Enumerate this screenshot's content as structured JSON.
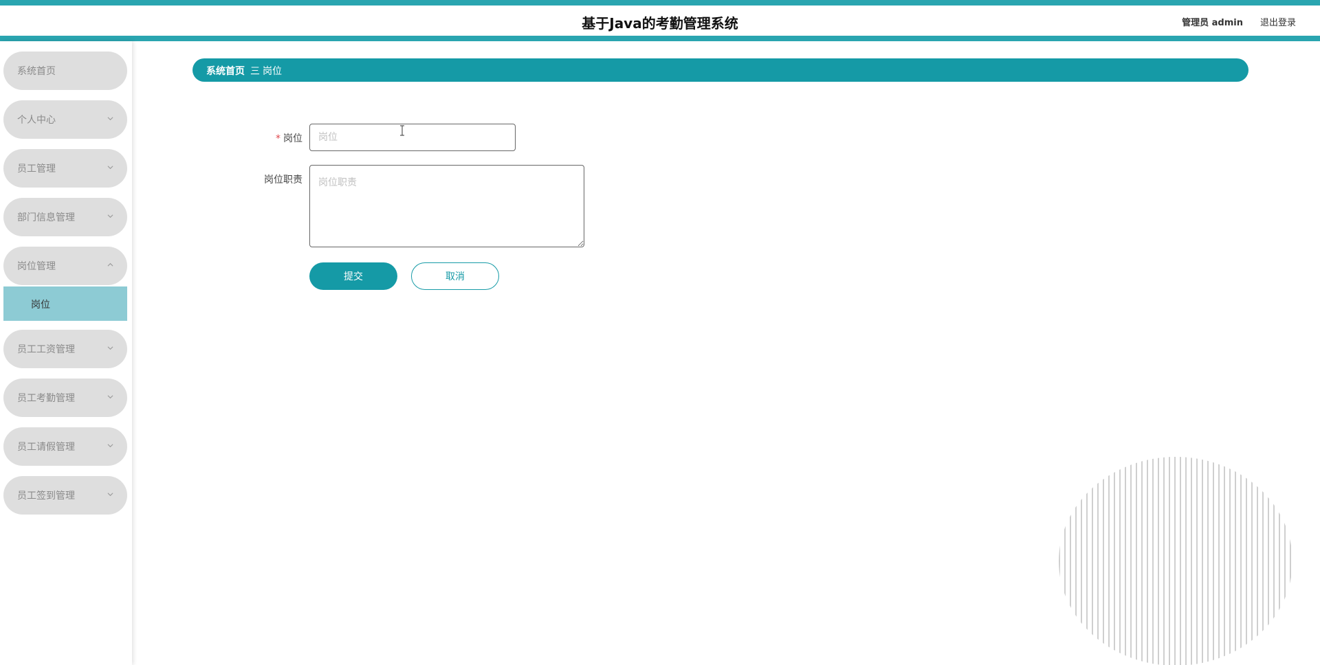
{
  "header": {
    "title": "基于Java的考勤管理系统",
    "user_label": "管理员 admin",
    "logout_label": "退出登录"
  },
  "sidebar": {
    "items": [
      {
        "label": "系统首页"
      },
      {
        "label": "个人中心"
      },
      {
        "label": "员工管理"
      },
      {
        "label": "部门信息管理"
      },
      {
        "label": "岗位管理"
      },
      {
        "label": "员工工资管理"
      },
      {
        "label": "员工考勤管理"
      },
      {
        "label": "员工请假管理"
      },
      {
        "label": "员工签到管理"
      }
    ],
    "active_subitem": {
      "label": "岗位"
    }
  },
  "breadcrumb": {
    "home": "系统首页",
    "separator": "三",
    "current": "岗位"
  },
  "form": {
    "position_label": "岗位",
    "position_required_mark": "*",
    "position_placeholder": "岗位",
    "position_value": "",
    "duty_label": "岗位职责",
    "duty_placeholder": "岗位职责",
    "duty_value": "",
    "submit_label": "提交",
    "cancel_label": "取消"
  },
  "colors": {
    "accent": "#159aa6",
    "header_border": "#2aa5b0",
    "submenu_active": "#8dcbd4",
    "menu_bg": "#dedede",
    "required": "#e0474c"
  }
}
